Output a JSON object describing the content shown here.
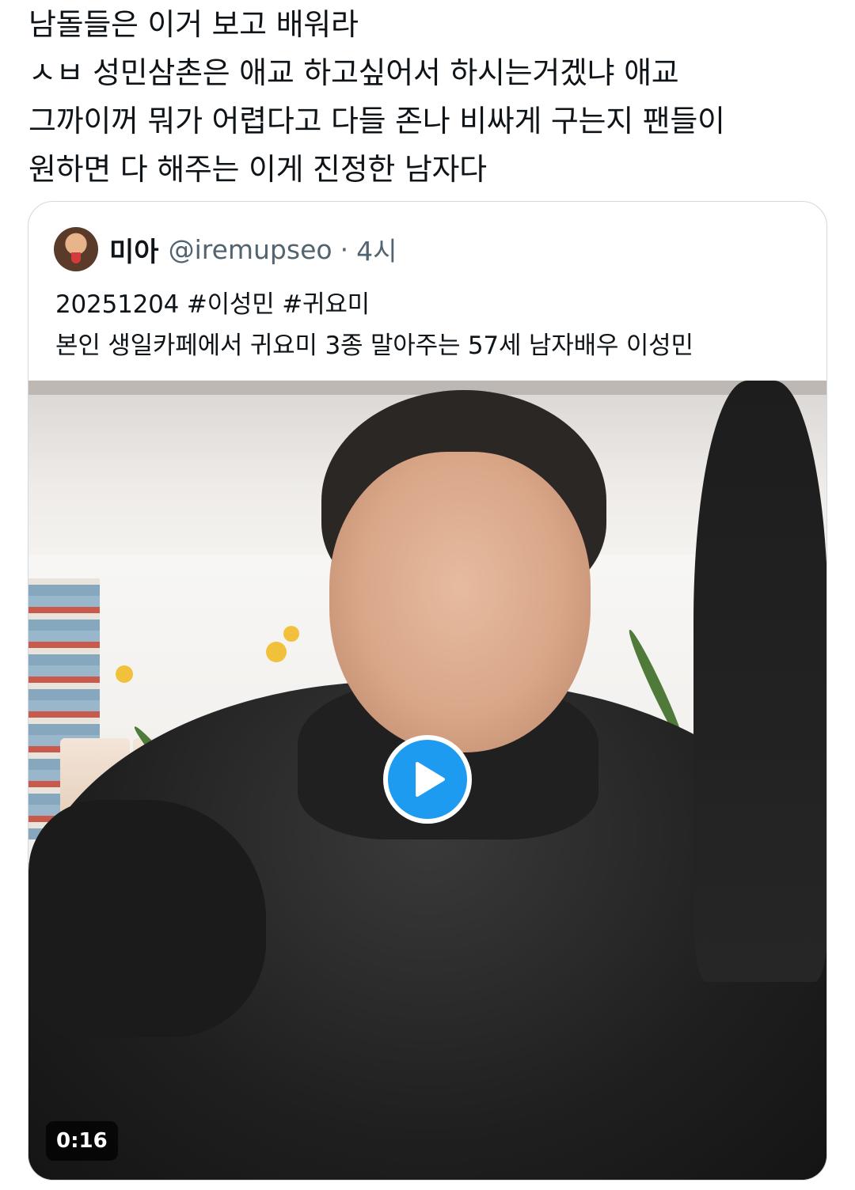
{
  "tweet": {
    "lines": [
      "남돌들은 이거 보고 배워라",
      "ㅅㅂ 성민삼촌은 애교 하고싶어서 하시는거겠냐 애교",
      "그까이꺼 뭐가 어렵다고 다들 존나 비싸게 구는지 팬들이",
      "원하면 다 해주는 이게 진정한 남자다"
    ]
  },
  "quote": {
    "display_name": "미아",
    "handle": "@iremupseo",
    "separator": "·",
    "time": "4시",
    "body_lines": [
      "20251204 #이성민 #귀요미",
      "본인 생일카페에서 귀요미 3종 말아주는 57세 남자배우 이성민"
    ],
    "media": {
      "duration": "0:16",
      "play_icon": "play-icon",
      "accent_color": "#1d9bf0"
    }
  }
}
